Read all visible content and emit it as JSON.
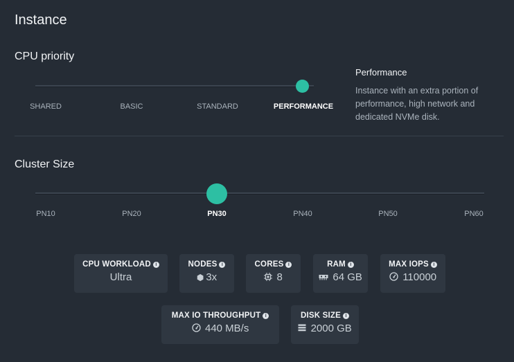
{
  "title": "Instance",
  "cpu": {
    "heading": "CPU priority",
    "options": [
      "SHARED",
      "BASIC",
      "STANDARD",
      "PERFORMANCE"
    ],
    "selected": "PERFORMANCE",
    "desc_title": "Performance",
    "desc_text": "Instance with an extra portion of performance, high network and dedicated NVMe disk."
  },
  "cluster": {
    "heading": "Cluster Size",
    "options": [
      "PN10",
      "PN20",
      "PN30",
      "PN40",
      "PN50",
      "PN60"
    ],
    "selected": "PN30"
  },
  "stats": [
    {
      "label": "CPU WORKLOAD",
      "value": "Ultra",
      "icon": ""
    },
    {
      "label": "NODES",
      "value": "3x",
      "icon": "hexagon-icon"
    },
    {
      "label": "CORES",
      "value": "8",
      "icon": "cpu-chip-icon"
    },
    {
      "label": "RAM",
      "value": "64 GB",
      "icon": "memory-icon"
    },
    {
      "label": "MAX IOPS",
      "value": "110000",
      "icon": "gauge-icon"
    },
    {
      "label": "MAX IO THROUGHPUT",
      "value": "440 MB/s",
      "icon": "gauge-icon"
    },
    {
      "label": "DISK SIZE",
      "value": "2000 GB",
      "icon": "disk-stack-icon"
    }
  ],
  "info_glyph": "i"
}
